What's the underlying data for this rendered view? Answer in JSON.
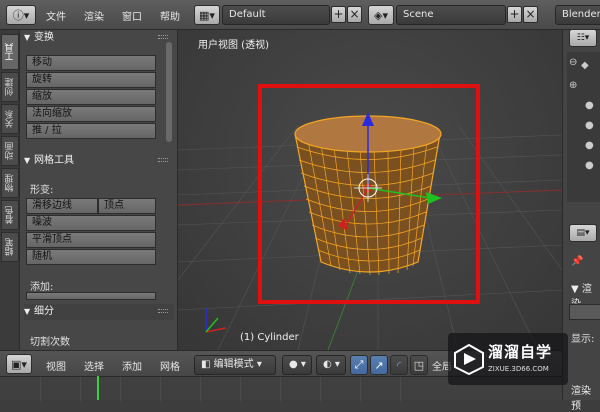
{
  "topbar": {
    "menus": [
      "文件",
      "渲染",
      "窗口",
      "帮助"
    ],
    "screen_layout": "Default",
    "scene": "Scene",
    "engine": "Blender"
  },
  "vtabs": [
    "工具",
    "创建",
    "关系",
    "动画",
    "物理",
    "着色",
    "蜡笔"
  ],
  "toolshelf": {
    "transform_header": "变换",
    "transform_buttons": [
      "移动",
      "旋转",
      "缩放",
      "法向缩放",
      "推 / 拉"
    ],
    "mesh_tools_header": "网格工具",
    "deform_label": "形变:",
    "slide_edge": "滑移边线",
    "vertex": "顶点",
    "noise": "噪波",
    "smooth_vertex": "平滑顶点",
    "random": "随机",
    "add_label": "添加:",
    "subdivide_header": "细分",
    "cuts_label": "切割次数"
  },
  "viewport": {
    "title": "用户视图 (透视)",
    "object_label": "(1) Cylinder"
  },
  "bottombar": {
    "menus": [
      "视图",
      "选择",
      "添加",
      "网格"
    ],
    "mode": "编辑模式",
    "global": "全局"
  },
  "rpanel": {
    "render_label": "渲染",
    "show_label": "显示:",
    "preset_label": "渲染预"
  },
  "watermark": {
    "title": "溜溜自学",
    "sub": "ZIXUE.3D66.COM"
  },
  "colors": {
    "mesh": "#f5a623",
    "highlight_box": "#e01010",
    "z_axis": "#2a2ae0",
    "x_axis": "#d22020",
    "y_axis": "#20c020",
    "frame_marker": "#3bd13b"
  }
}
